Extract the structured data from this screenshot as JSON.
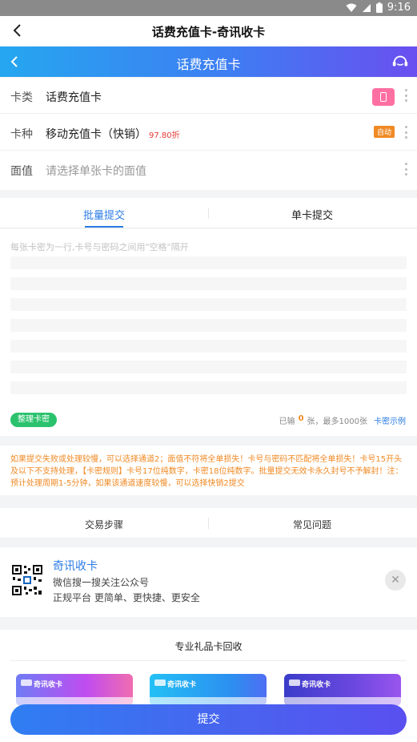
{
  "status_bar": {
    "time": "9:16",
    "icons": [
      "wifi-icon",
      "signal-icon",
      "battery-icon"
    ]
  },
  "app_bar": {
    "title": "话费充值卡-奇讯收卡",
    "back_icon": "chevron-left-icon"
  },
  "banner": {
    "title": "话费充值卡",
    "service_icon": "customer-service-icon"
  },
  "form": {
    "card_type": {
      "label": "卡类",
      "value": "话费充值卡"
    },
    "card_kind": {
      "label": "卡种",
      "value": "移动充值卡（快销）",
      "discount": "97.80折",
      "badge": "自动"
    },
    "face_value": {
      "label": "面值",
      "placeholder": "请选择单张卡的面值"
    }
  },
  "submit_tabs": {
    "batch": "批量提交",
    "single": "单卡提交"
  },
  "editor": {
    "placeholder": "每张卡密为一行,卡号与密码之间用\"空格\"隔开"
  },
  "tools": {
    "tidy_label": "整理卡密",
    "entered_prefix": "已输",
    "entered_count": "0",
    "entered_suffix": "张，最多1000张",
    "example_link": "卡密示例"
  },
  "notice": "如果提交失败或处理较慢，可以选择通道2；面值不符将全单损失！卡号与密码不匹配将全单损失！卡号15开头及以下不支持处理，【卡密规则】卡号17位纯数字，卡密18位纯数字。批量提交无效卡永久封号不予解封！注：预计处理周期1-5分钟，如果该通道速度较慢，可以选择快销2提交",
  "info_tabs": {
    "steps": "交易步骤",
    "faq": "常见问题"
  },
  "promo": {
    "name": "奇讯收卡",
    "line1": "微信搜一搜关注公众号",
    "line2": "正规平台 更简单、更快捷、更安全"
  },
  "gift_section": {
    "heading": "专业礼品卡回收",
    "cards": [
      {
        "title": "奇讯收卡",
        "color": "#b84cf0"
      },
      {
        "title": "奇讯收卡",
        "color": "#2bb5f0"
      },
      {
        "title": "奇讯收卡",
        "color": "#5a3fd6"
      }
    ]
  },
  "submit_button": "提交",
  "colors": {
    "accent": "#2a7be4",
    "warning": "#f08a24",
    "discount": "#e53935",
    "success": "#2bc26e"
  }
}
